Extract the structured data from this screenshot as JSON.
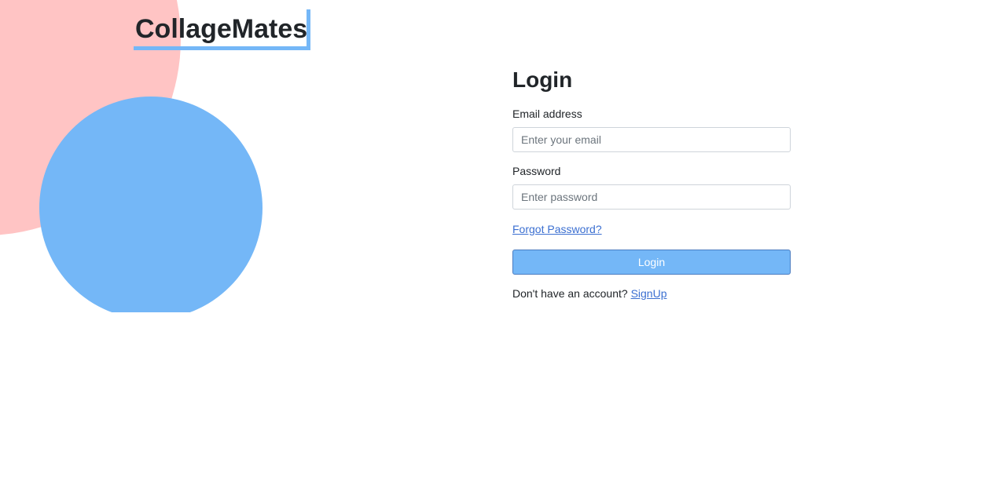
{
  "brand": {
    "name": "CollageMates"
  },
  "login": {
    "title": "Login",
    "email_label": "Email address",
    "email_placeholder": "Enter your email",
    "email_value": "",
    "password_label": "Password",
    "password_placeholder": "Enter password",
    "password_value": "",
    "forgot_label": "Forgot Password?",
    "submit_label": "Login",
    "no_account_text": "Don't have an account?",
    "signup_label": "SignUp"
  },
  "colors": {
    "accent": "#74b7f7",
    "decor_pink": "#ffc4c4",
    "link": "#3b6fd1"
  }
}
